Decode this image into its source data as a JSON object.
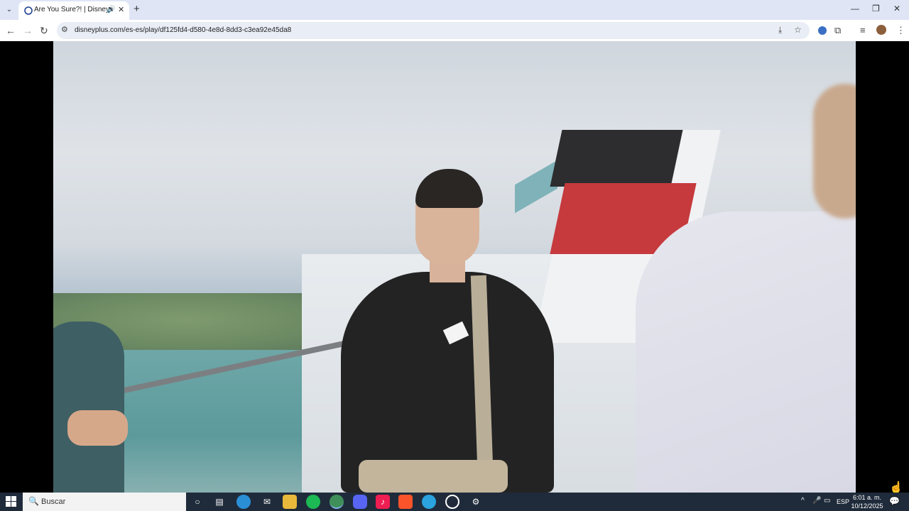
{
  "browser": {
    "tab_menu_icon": "⌄",
    "tab_title": "Are You Sure?! | Disney+",
    "tab_audio_icon": "🔊",
    "tab_close": "✕",
    "new_tab": "+",
    "minimize": "—",
    "maximize": "❐",
    "close": "✕",
    "back": "←",
    "forward": "→",
    "reload": "↻",
    "site_info_icon": "⚙",
    "url": "disneyplus.com/es-es/play/df125fd4-d580-4e8d-8dd3-c3ea92e45da8",
    "install_icon": "⤓",
    "bookmark_icon": "☆",
    "extensions_icon": "⧉",
    "media_icon": "≡",
    "menu_icon": "⋮"
  },
  "taskbar": {
    "search_placeholder": "Buscar",
    "search_icon": "🔍",
    "language": "ESP",
    "time": "6:01 a. m.",
    "date": "10/12/2025",
    "tray_up": "^",
    "mic_icon": "🎤",
    "network_icon": "▭",
    "notification_icon": "💬"
  },
  "apps": [
    "cortana",
    "task-view",
    "edge",
    "mail",
    "file-explorer",
    "spotify",
    "chrome",
    "discord",
    "tiktok",
    "brave",
    "telegram",
    "obs",
    "settings"
  ]
}
